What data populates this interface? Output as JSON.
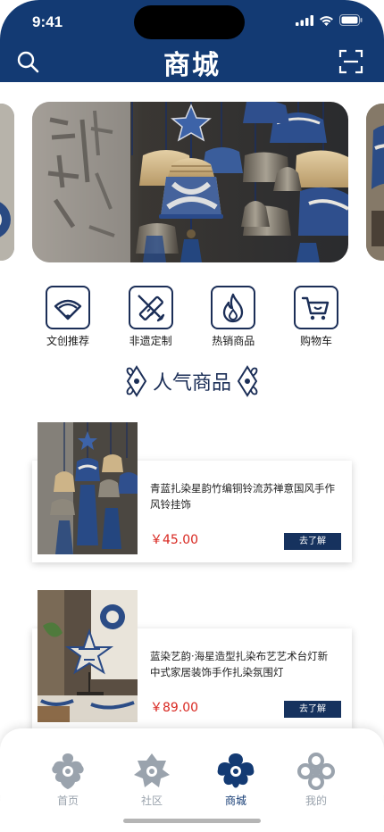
{
  "status_bar": {
    "time": "9:41"
  },
  "header": {
    "title": "商城",
    "left_icon": "search-icon",
    "right_icon": "scan-icon",
    "color": "#133a73"
  },
  "categories": [
    {
      "label": "文创推荐",
      "icon": "fan-icon"
    },
    {
      "label": "非遗定制",
      "icon": "pencil-ruler-icon"
    },
    {
      "label": "热销商品",
      "icon": "flame-icon"
    },
    {
      "label": "购物车",
      "icon": "cart-icon"
    }
  ],
  "section_title": "人气商品",
  "products": [
    {
      "name": "青蓝扎染星韵竹编铜铃流苏禅意国风手作风铃挂饰",
      "price": "￥45.00",
      "button": "去了解"
    },
    {
      "name": "蓝染艺韵·海星造型扎染布艺艺术台灯新中式家居装饰手作扎染氛围灯",
      "price": "￥89.00",
      "button": "去了解"
    }
  ],
  "tabbar": {
    "items": [
      {
        "label": "首页",
        "active": false
      },
      {
        "label": "社区",
        "active": false
      },
      {
        "label": "商城",
        "active": true
      },
      {
        "label": "我的",
        "active": false
      }
    ],
    "active_color": "#133a73",
    "inactive_color": "#9aa3ad"
  }
}
